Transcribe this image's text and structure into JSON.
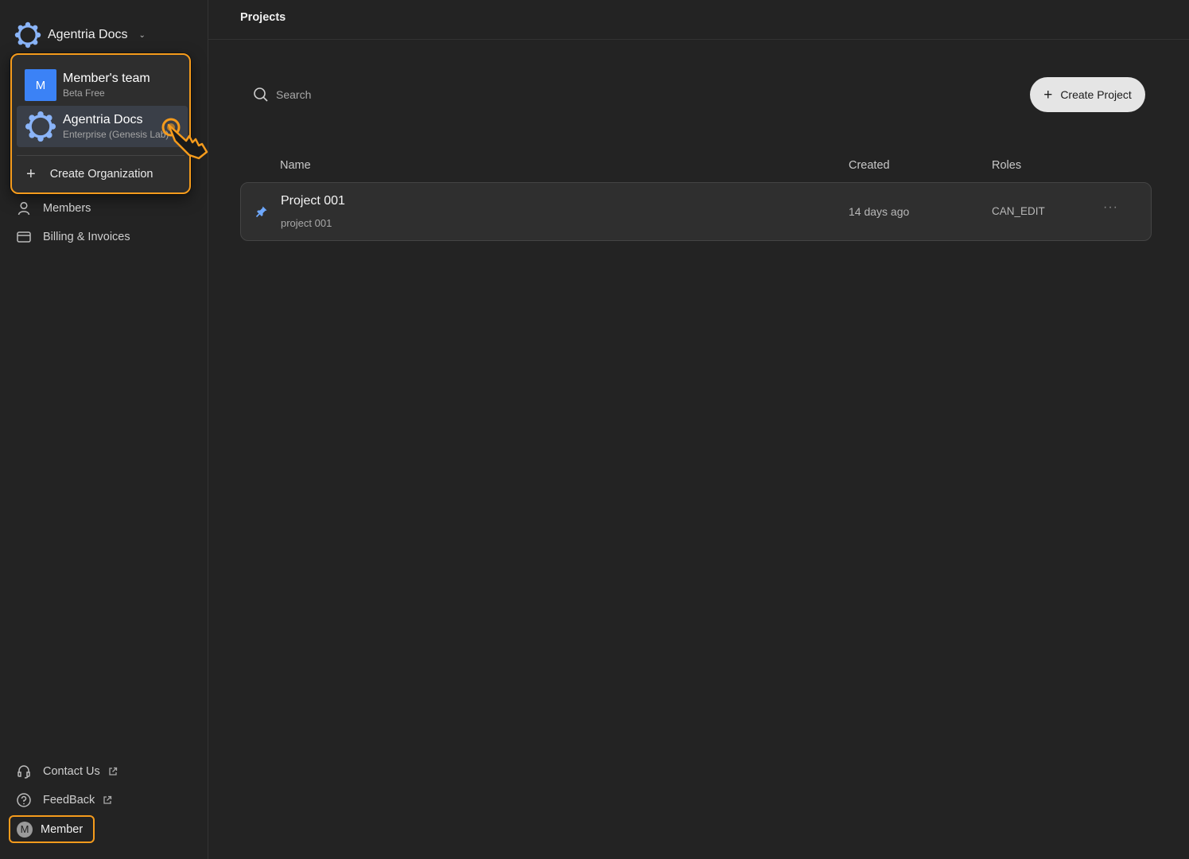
{
  "org_switcher": {
    "current_org": "Agentria Docs",
    "chevron_icon": "chevron-down-icon"
  },
  "dropdown": {
    "items": [
      {
        "avatar_letter": "M",
        "title": "Member's team",
        "subtitle": "Beta Free",
        "selected": false
      },
      {
        "title": "Agentria Docs",
        "subtitle": "Enterprise (Genesis Lab)",
        "selected": true
      }
    ],
    "create_label": "Create Organization"
  },
  "sidebar": {
    "items": [
      {
        "label": "Members",
        "icon": "person-icon"
      },
      {
        "label": "Billing & Invoices",
        "icon": "credit-card-icon"
      }
    ],
    "footer": [
      {
        "label": "Contact Us",
        "icon": "headset-icon",
        "external": true
      },
      {
        "label": "FeedBack",
        "icon": "question-circle-icon",
        "external": true
      }
    ],
    "user": {
      "avatar_letter": "M",
      "label": "Member"
    }
  },
  "header": {
    "title": "Projects"
  },
  "toolbar": {
    "search_placeholder": "Search",
    "create_label": "Create Project"
  },
  "table": {
    "columns": [
      "Name",
      "Created",
      "Roles"
    ],
    "rows": [
      {
        "name": "Project 001",
        "subtitle": "project 001",
        "created": "14 days ago",
        "role": "CAN_EDIT",
        "pinned": true,
        "more": "···"
      }
    ]
  },
  "colors": {
    "background": "#232323",
    "highlight": "#f59b1c",
    "avatar_blue": "#3b82f6",
    "logo_blue": "#8ab4f8"
  }
}
